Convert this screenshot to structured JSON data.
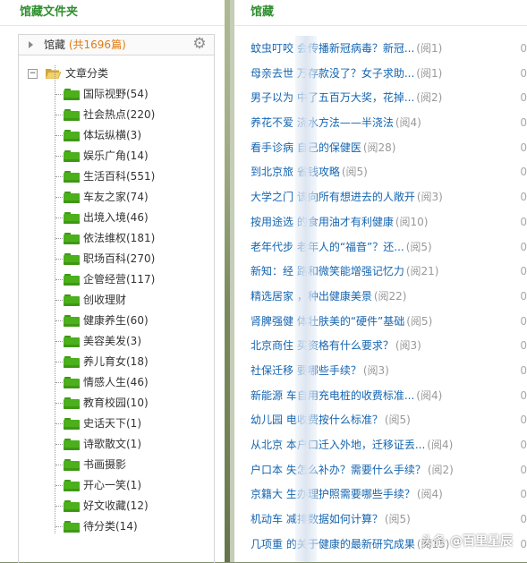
{
  "left_panel": {
    "title": "馆藏文件夹",
    "root": {
      "label": "馆藏",
      "count": "(共1696篇)"
    },
    "category_root": "文章分类",
    "folders": [
      "国际视野(54)",
      "社会热点(220)",
      "体坛纵横(3)",
      "娱乐广角(14)",
      "生活百科(551)",
      "车友之家(74)",
      "出境入境(46)",
      "依法维权(181)",
      "职场百科(270)",
      "企管经营(117)",
      "创收理财",
      "健康养生(60)",
      "美容美发(3)",
      "养儿育女(18)",
      "情感人生(46)",
      "教育校园(10)",
      "史话天下(1)",
      "诗歌散文(1)",
      "书画摄影",
      "开心一笑(1)",
      "好文收藏(12)",
      "待分类(14)"
    ]
  },
  "right_panel": {
    "title": "馆藏",
    "items": [
      {
        "title": "蚊虫叮咬 会传播新冠病毒？新冠...",
        "reads": "(阅1)"
      },
      {
        "title": "母亲去世 万存款没了？女子求助...",
        "reads": "(阅1)"
      },
      {
        "title": "男子以为 中了五百万大奖，花掉...",
        "reads": "(阅2)"
      },
      {
        "title": "养花不爱 浇水方法——半浇法",
        "reads": "(阅4)"
      },
      {
        "title": "看手诊病 自己的保健医",
        "reads": "(阅28)"
      },
      {
        "title": "到北京旅 省钱攻略",
        "reads": "(阅5)"
      },
      {
        "title": "大学之门 该向所有想进去的人敞开",
        "reads": "(阅3)"
      },
      {
        "title": "按用途选 的食用油才有利健康",
        "reads": "(阅10)"
      },
      {
        "title": "老年代步 老年人的“福音”？还...",
        "reads": "(阅5)"
      },
      {
        "title": "新知：经 路和微笑能增强记忆力",
        "reads": "(阅21)"
      },
      {
        "title": "精选居家 ，种出健康美景",
        "reads": "(阅22)"
      },
      {
        "title": "肾脾强健 体壮肤美的“硬件”基础",
        "reads": "(阅5)"
      },
      {
        "title": "北京商住 买资格有什么要求？",
        "reads": "(阅3)"
      },
      {
        "title": "社保迁移 要哪些手续？",
        "reads": "(阅3)"
      },
      {
        "title": "新能源 车自用充电桩的收费标准...",
        "reads": "(阅4)"
      },
      {
        "title": "幼儿园 电收费按什么标准？",
        "reads": "(阅5)"
      },
      {
        "title": "从北京 本户口迁入外地，迁移证丢...",
        "reads": "(阅4)"
      },
      {
        "title": "户口本 失怎么补办？需要什么手续？",
        "reads": "(阅2)"
      },
      {
        "title": "京籍大 生办理护照需要哪些手续？",
        "reads": "(阅4)"
      },
      {
        "title": "机动车 减排数据如何计算？",
        "reads": "(阅5)"
      },
      {
        "title": "几项重 的关于健康的最新研究成果",
        "reads": "(阅15)"
      }
    ],
    "edge_char": "0"
  },
  "watermark": {
    "prefix": "头条",
    "handle": "@百里星辰"
  },
  "colors": {
    "green_title": "#2f8e2f",
    "link_blue": "#1565b0",
    "count_orange": "#e07b14",
    "folder_green": "#4caf1c"
  }
}
